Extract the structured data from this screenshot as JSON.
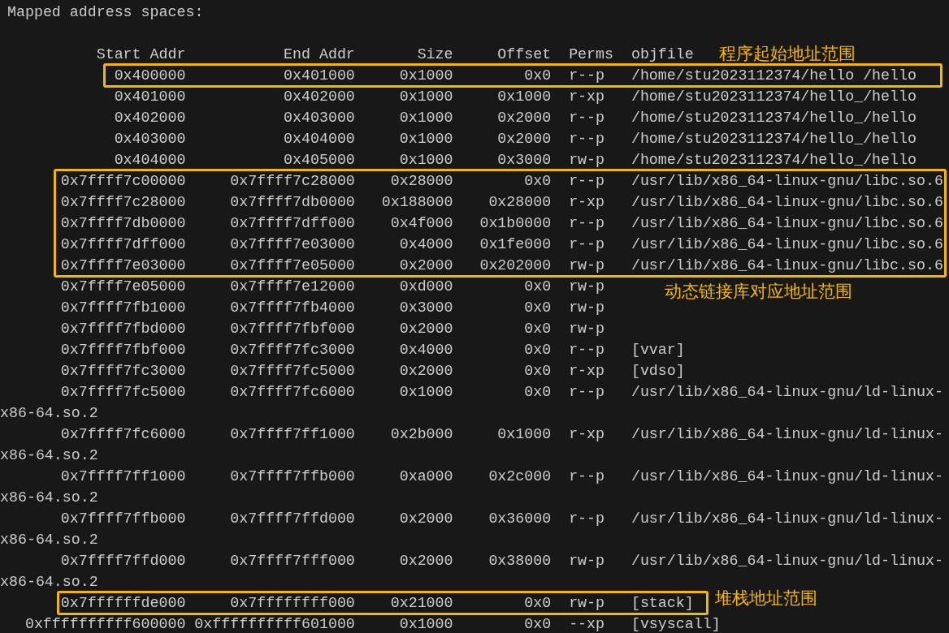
{
  "heading": "Mapped address spaces:",
  "columns": [
    "Start Addr",
    "End Addr",
    "Size",
    "Offset",
    "Perms",
    "objfile"
  ],
  "sections": [
    {
      "label": "程序起始地址范围",
      "rows": [
        {
          "start": "0x400000",
          "end": "0x401000",
          "size": "0x1000",
          "offset": "0x0",
          "perms": "r--p",
          "objfile": "/home/stu2023112374/hello /hello"
        }
      ]
    },
    {
      "rows": [
        {
          "start": "0x401000",
          "end": "0x402000",
          "size": "0x1000",
          "offset": "0x1000",
          "perms": "r-xp",
          "objfile": "/home/stu2023112374/hello_/hello"
        },
        {
          "start": "0x402000",
          "end": "0x403000",
          "size": "0x1000",
          "offset": "0x2000",
          "perms": "r--p",
          "objfile": "/home/stu2023112374/hello_/hello"
        },
        {
          "start": "0x403000",
          "end": "0x404000",
          "size": "0x1000",
          "offset": "0x2000",
          "perms": "r--p",
          "objfile": "/home/stu2023112374/hello_/hello"
        },
        {
          "start": "0x404000",
          "end": "0x405000",
          "size": "0x1000",
          "offset": "0x3000",
          "perms": "rw-p",
          "objfile": "/home/stu2023112374/hello_/hello"
        }
      ]
    },
    {
      "label": "动态链接库对应地址范围",
      "rows": [
        {
          "start": "0x7ffff7c00000",
          "end": "0x7ffff7c28000",
          "size": "0x28000",
          "offset": "0x0",
          "perms": "r--p",
          "objfile": "/usr/lib/x86_64-linux-gnu/libc.so.6"
        },
        {
          "start": "0x7ffff7c28000",
          "end": "0x7ffff7db0000",
          "size": "0x188000",
          "offset": "0x28000",
          "perms": "r-xp",
          "objfile": "/usr/lib/x86_64-linux-gnu/libc.so.6"
        },
        {
          "start": "0x7ffff7db0000",
          "end": "0x7ffff7dff000",
          "size": "0x4f000",
          "offset": "0x1b0000",
          "perms": "r--p",
          "objfile": "/usr/lib/x86_64-linux-gnu/libc.so.6"
        },
        {
          "start": "0x7ffff7dff000",
          "end": "0x7ffff7e03000",
          "size": "0x4000",
          "offset": "0x1fe000",
          "perms": "r--p",
          "objfile": "/usr/lib/x86_64-linux-gnu/libc.so.6"
        },
        {
          "start": "0x7ffff7e03000",
          "end": "0x7ffff7e05000",
          "size": "0x2000",
          "offset": "0x202000",
          "perms": "rw-p",
          "objfile": "/usr/lib/x86_64-linux-gnu/libc.so.6"
        }
      ]
    },
    {
      "rows": [
        {
          "start": "0x7ffff7e05000",
          "end": "0x7ffff7e12000",
          "size": "0xd000",
          "offset": "0x0",
          "perms": "rw-p"
        },
        {
          "start": "0x7ffff7fb1000",
          "end": "0x7ffff7fb4000",
          "size": "0x3000",
          "offset": "0x0",
          "perms": "rw-p"
        },
        {
          "start": "0x7ffff7fbd000",
          "end": "0x7ffff7fbf000",
          "size": "0x2000",
          "offset": "0x0",
          "perms": "rw-p"
        },
        {
          "start": "0x7ffff7fbf000",
          "end": "0x7ffff7fc3000",
          "size": "0x4000",
          "offset": "0x0",
          "perms": "r--p",
          "objfile": "[vvar]"
        },
        {
          "start": "0x7ffff7fc3000",
          "end": "0x7ffff7fc5000",
          "size": "0x2000",
          "offset": "0x0",
          "perms": "r-xp",
          "objfile": "[vdso]"
        },
        {
          "start": "0x7ffff7fc5000",
          "end": "0x7ffff7fc6000",
          "size": "0x1000",
          "offset": "0x0",
          "perms": "r--p",
          "objfile": "/usr/lib/x86_64-linux-gnu/ld-linux-",
          "objfile_wrap": "x86-64.so.2"
        },
        {
          "start": "0x7ffff7fc6000",
          "end": "0x7ffff7ff1000",
          "size": "0x2b000",
          "offset": "0x1000",
          "perms": "r-xp",
          "objfile": "/usr/lib/x86_64-linux-gnu/ld-linux-",
          "objfile_wrap": "x86-64.so.2"
        },
        {
          "start": "0x7ffff7ff1000",
          "end": "0x7ffff7ffb000",
          "size": "0xa000",
          "offset": "0x2c000",
          "perms": "r--p",
          "objfile": "/usr/lib/x86_64-linux-gnu/ld-linux-",
          "objfile_wrap": "x86-64.so.2"
        },
        {
          "start": "0x7ffff7ffb000",
          "end": "0x7ffff7ffd000",
          "size": "0x2000",
          "offset": "0x36000",
          "perms": "r--p",
          "objfile": "/usr/lib/x86_64-linux-gnu/ld-linux-",
          "objfile_wrap": "x86-64.so.2"
        },
        {
          "start": "0x7ffff7ffd000",
          "end": "0x7ffff7fff000",
          "size": "0x2000",
          "offset": "0x38000",
          "perms": "rw-p",
          "objfile": "/usr/lib/x86_64-linux-gnu/ld-linux-",
          "objfile_wrap": "x86-64.so.2"
        }
      ]
    },
    {
      "label": "堆栈地址范围",
      "rows": [
        {
          "start": "0x7ffffffde000",
          "end": "0x7ffffffff000",
          "size": "0x21000",
          "offset": "0x0",
          "perms": "rw-p",
          "objfile": "[stack]"
        }
      ]
    },
    {
      "rows": [
        {
          "start": "0xffffffffff600000",
          "end": "0xffffffffff601000",
          "size": "0x1000",
          "offset": "0x0",
          "perms": "--xp",
          "objfile": "[vsyscall]"
        }
      ]
    }
  ]
}
